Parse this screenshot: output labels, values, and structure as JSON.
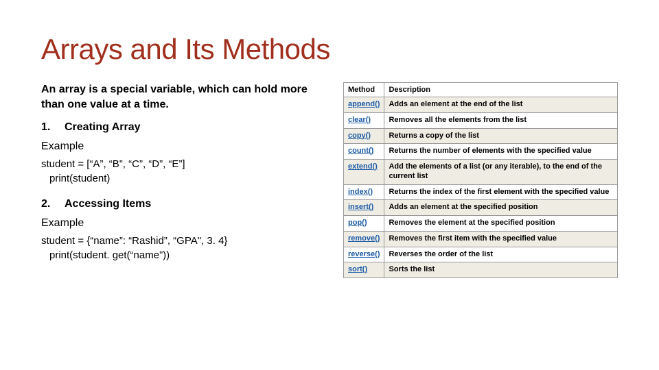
{
  "title": "Arrays and Its Methods",
  "left": {
    "intro": "An array is a special variable, which can hold more than one value at a time.",
    "sections": [
      {
        "num": "1.",
        "heading": "Creating Array",
        "exampleLabel": "Example",
        "code_line1": "student = [“A”, “B”, “C”, “D”, “E”]",
        "code_line2": "print(student)"
      },
      {
        "num": "2.",
        "heading": "Accessing Items",
        "exampleLabel": "Example",
        "code_line1": "student = {“name”: “Rashid”, “GPA\", 3. 4}",
        "code_line2": "print(student. get(“name”))"
      }
    ]
  },
  "table": {
    "headers": {
      "method": "Method",
      "description": "Description"
    },
    "rows": [
      {
        "method": "append()",
        "desc": "Adds an element at the end of the list"
      },
      {
        "method": "clear()",
        "desc": "Removes all the elements from the list"
      },
      {
        "method": "copy()",
        "desc": "Returns a copy of the list"
      },
      {
        "method": "count()",
        "desc": "Returns the number of elements with the specified value"
      },
      {
        "method": "extend()",
        "desc": "Add the elements of a list (or any iterable), to the end of the current list"
      },
      {
        "method": "index()",
        "desc": "Returns the index of the first element with the specified value"
      },
      {
        "method": "insert()",
        "desc": "Adds an element at the specified position"
      },
      {
        "method": "pop()",
        "desc": "Removes the element at the specified position"
      },
      {
        "method": "remove()",
        "desc": "Removes the first item with the specified value"
      },
      {
        "method": "reverse()",
        "desc": "Reverses the order of the list"
      },
      {
        "method": "sort()",
        "desc": "Sorts the list"
      }
    ]
  }
}
